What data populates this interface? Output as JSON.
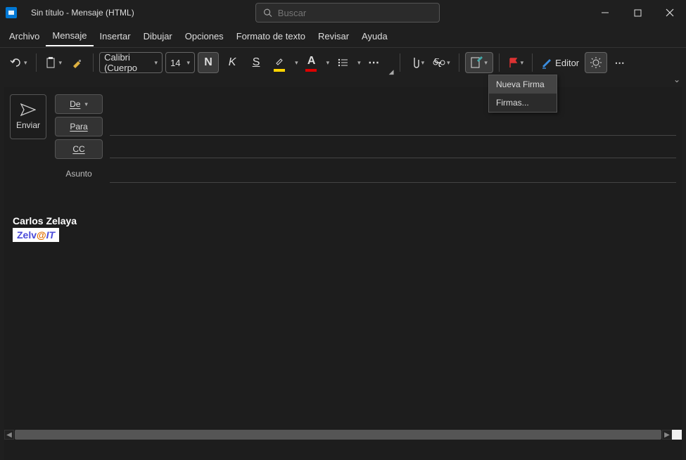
{
  "window": {
    "title": "Sin título  -  Mensaje (HTML)",
    "search_placeholder": "Buscar"
  },
  "menu": {
    "items": [
      "Archivo",
      "Mensaje",
      "Insertar",
      "Dibujar",
      "Opciones",
      "Formato de texto",
      "Revisar",
      "Ayuda"
    ],
    "active_index": 1
  },
  "ribbon": {
    "font_name": "Calibri (Cuerpo",
    "font_size": "14",
    "bold_label": "N",
    "italic_label": "K",
    "underline_label": "S",
    "editor_label": "Editor",
    "highlight_color": "#ffd400",
    "font_color": "#d00000"
  },
  "signature_dropdown": {
    "items": [
      "Nueva Firma",
      "Firmas..."
    ],
    "hover_index": 0
  },
  "compose": {
    "send_label": "Enviar",
    "from_label": "De",
    "to_label": "Para",
    "cc_label": "CC",
    "subject_label": "Asunto",
    "to_value": "",
    "cc_value": "",
    "subject_value": ""
  },
  "signature_body": {
    "name": "Carlos Zelaya",
    "logo_part1": "Zelv",
    "logo_at": "@",
    "logo_part2": "IT"
  }
}
